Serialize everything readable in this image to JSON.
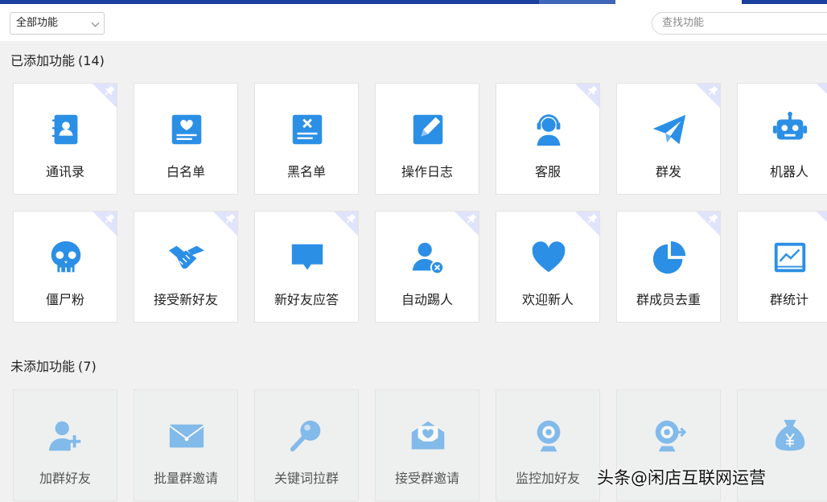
{
  "toolbar": {
    "filter_value": "全部功能",
    "search_placeholder": "查找功能"
  },
  "added": {
    "title": "已添加功能",
    "count": "(14)",
    "items": [
      {
        "label": "通讯录",
        "icon": "contacts-book-icon",
        "pinned": true
      },
      {
        "label": "白名单",
        "icon": "whitelist-card-icon",
        "pinned": false
      },
      {
        "label": "黑名单",
        "icon": "blacklist-card-icon",
        "pinned": false
      },
      {
        "label": "操作日志",
        "icon": "edit-log-icon",
        "pinned": false
      },
      {
        "label": "客服",
        "icon": "headset-agent-icon",
        "pinned": true
      },
      {
        "label": "群发",
        "icon": "paper-plane-icon",
        "pinned": true
      },
      {
        "label": "机器人",
        "icon": "robot-icon",
        "pinned": true
      },
      {
        "label": "僵尸粉",
        "icon": "skull-icon",
        "pinned": true
      },
      {
        "label": "接受新好友",
        "icon": "handshake-icon",
        "pinned": true
      },
      {
        "label": "新好友应答",
        "icon": "chat-bubble-icon",
        "pinned": true
      },
      {
        "label": "自动踢人",
        "icon": "user-remove-icon",
        "pinned": true
      },
      {
        "label": "欢迎新人",
        "icon": "heart-icon",
        "pinned": true
      },
      {
        "label": "群成员去重",
        "icon": "pie-chart-icon",
        "pinned": true
      },
      {
        "label": "群统计",
        "icon": "line-chart-icon",
        "pinned": true
      }
    ]
  },
  "not_added": {
    "title": "未添加功能",
    "count": "(7)",
    "items": [
      {
        "label": "加群好友",
        "icon": "user-add-icon"
      },
      {
        "label": "批量群邀请",
        "icon": "envelope-icon"
      },
      {
        "label": "关键词拉群",
        "icon": "magnifier-icon"
      },
      {
        "label": "接受群邀请",
        "icon": "envelope-heart-icon"
      },
      {
        "label": "监控加好友",
        "icon": "webcam-icon"
      },
      {
        "label": "",
        "icon": "webcam-arrow-icon"
      },
      {
        "label": "",
        "icon": "money-bag-icon"
      }
    ]
  },
  "watermark": "头条@闲店互联网运营",
  "colors": {
    "accent": "#2b8fe6",
    "pin_badge": "#dfe3fb",
    "top_strip": "#1a3f9c"
  }
}
